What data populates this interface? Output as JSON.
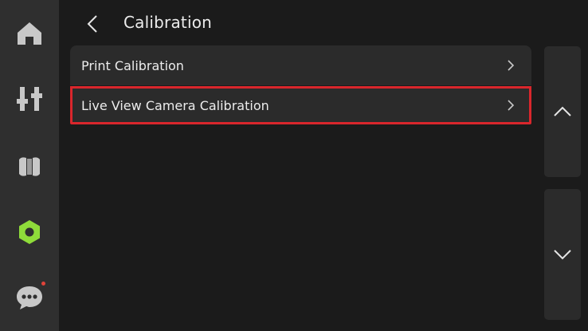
{
  "header": {
    "title": "Calibration"
  },
  "nav": {
    "items": [
      {
        "name": "home",
        "icon": "home-icon"
      },
      {
        "name": "controls",
        "icon": "sliders-icon"
      },
      {
        "name": "filament",
        "icon": "filament-spool-icon"
      },
      {
        "name": "settings",
        "icon": "hex-nut-settings-icon",
        "active": true
      },
      {
        "name": "messages",
        "icon": "chat-bubble-icon",
        "has_notification": true
      }
    ],
    "active_color": "#8fdc3a",
    "icon_color": "#c8c8c8",
    "notification_color": "#e0433a"
  },
  "calibration": {
    "items": [
      {
        "label": "Print Calibration"
      },
      {
        "label": "Live View Camera Calibration",
        "highlighted": true
      }
    ]
  },
  "scroll": {
    "up_icon": "chevron-up-icon",
    "down_icon": "chevron-down-icon"
  },
  "colors": {
    "background": "#1b1b1b",
    "rail": "#2f2f2f",
    "panel": "#2b2b2b",
    "highlight_border": "#d9262c"
  }
}
